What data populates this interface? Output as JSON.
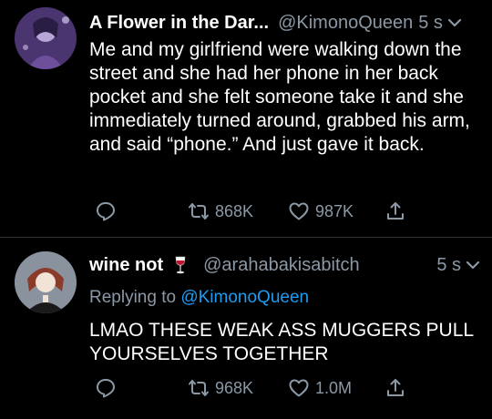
{
  "tweets": [
    {
      "display_name": "A Flower in the Dar...",
      "handle": "@KimonoQueen",
      "time": "5 s",
      "text": "Me and my girlfriend were walking down the street and she had her phone in her back pocket and she felt someone take it and she immediately turned around, grabbed his arm, and said “phone.” And just gave it back.",
      "retweets": "868K",
      "likes": "987K"
    },
    {
      "display_name": "wine not",
      "handle": "@arahabakisabitch",
      "time": "5 s",
      "replying_prefix": "Replying to",
      "replying_to": "@KimonoQueen",
      "text": "LMAO THESE WEAK ASS MUGGERS PULL YOURSELVES TOGETHER",
      "retweets": "968K",
      "likes": "1.0M"
    }
  ],
  "colors": {
    "background": "#000000",
    "text": "#ffffff",
    "secondary": "#8b98a5",
    "link": "#1d9bf0"
  },
  "icons": [
    "reply-icon",
    "retweet-icon",
    "like-icon",
    "share-icon",
    "chevron-down-icon",
    "wine-glass-icon"
  ]
}
